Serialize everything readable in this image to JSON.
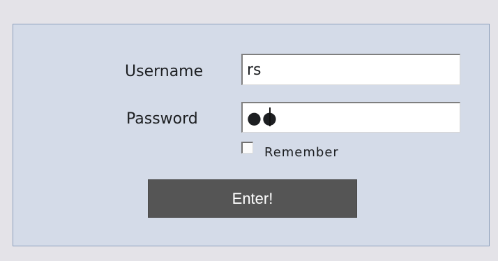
{
  "login": {
    "username_label": "Username",
    "username_value": "rs",
    "password_label": "Password",
    "password_value": "●●",
    "remember_label": "Remember",
    "remember_checked": false,
    "submit_label": "Enter!"
  },
  "colors": {
    "page_background": "#e4e3e8",
    "panel_background": "#d4dbe8",
    "panel_border": "#8da0bd",
    "button_background": "#555555",
    "button_text": "#ffffff"
  }
}
